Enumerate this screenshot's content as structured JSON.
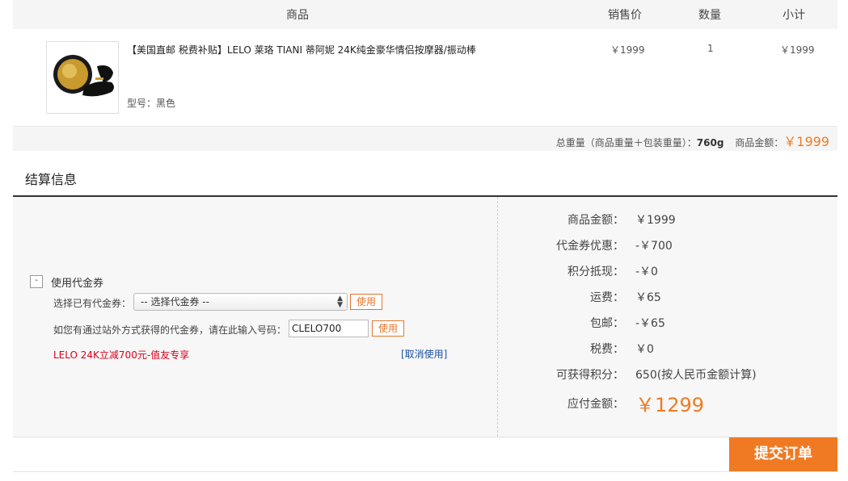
{
  "table_header": {
    "product": "商品",
    "price": "销售价",
    "qty": "数量",
    "subtotal": "小计"
  },
  "product": {
    "title": "【美国直邮 税费补贴】LELO 莱珞 TIANI 蒂阿妮 24K纯金豪华情侣按摩器/振动棒",
    "model_label": "型号：黑色",
    "price": "￥1999",
    "qty": "1",
    "subtotal": "￥1999"
  },
  "totals": {
    "weight_label": "总重量（商品重量＋包装重量）：",
    "weight_value": "760g",
    "amount_label": "商品金额：",
    "amount_value": "￥1999"
  },
  "section_title": "结算信息",
  "coupon": {
    "toggle_symbol": "-",
    "title": "使用代金券",
    "select_label": "选择已有代金券：",
    "select_value": "-- 选择代金券 --",
    "use_label": "使用",
    "code_label": "如您有通过站外方式获得的代金券，请在此输入号码：",
    "code_value": "CLELO700",
    "code_use_label": "使用",
    "applied_text": "LELO 24K立减700元-值友专享",
    "cancel_label": "[取消使用]"
  },
  "summary": [
    {
      "label": "商品金额：",
      "value": "￥1999"
    },
    {
      "label": "代金券优惠：",
      "value": "-￥700"
    },
    {
      "label": "积分抵现：",
      "value": "-￥0"
    },
    {
      "label": "运费：",
      "value": "￥65"
    },
    {
      "label": "包邮：",
      "value": "-￥65"
    },
    {
      "label": "税费：",
      "value": "￥0"
    },
    {
      "label": "可获得积分：",
      "value": "650(按人民币金额计算)"
    }
  ],
  "payable": {
    "label": "应付金额：",
    "value": "￥1299"
  },
  "submit_label": "提交订单",
  "colors": {
    "accent": "#f07a23",
    "alert_red": "#d9001b",
    "link_blue": "#1a4fa0"
  }
}
